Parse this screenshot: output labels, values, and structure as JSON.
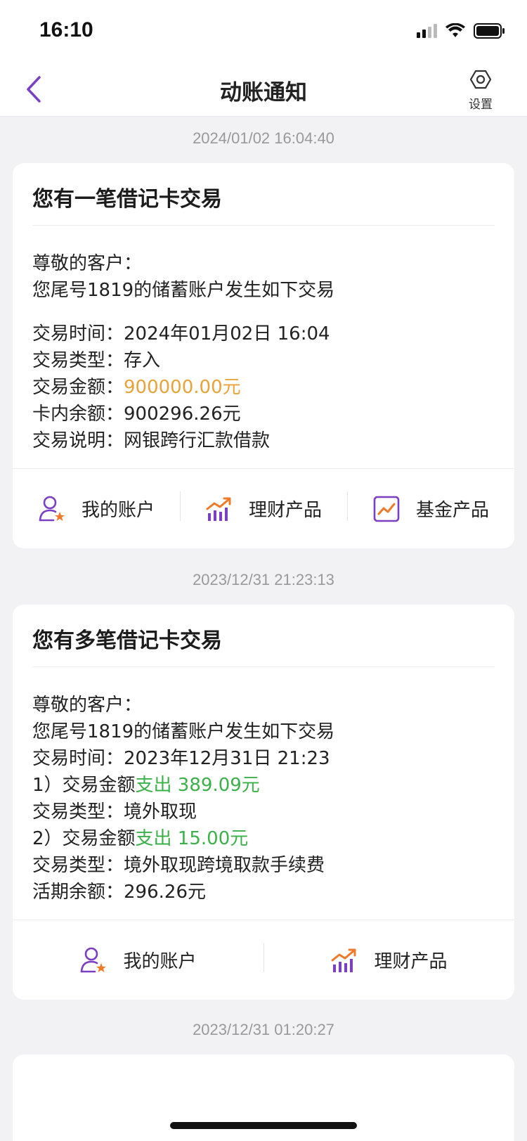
{
  "status": {
    "time": "16:10"
  },
  "nav": {
    "title": "动账通知",
    "settings_label": "设置"
  },
  "notifications": [
    {
      "timestamp": "2024/01/02 16:04:40",
      "title": "您有一笔借记卡交易",
      "greeting": "尊敬的客户：",
      "intro": "您尾号1819的储蓄账户发生如下交易",
      "time_label": "交易时间：",
      "time_value": "2024年01月02日  16:04",
      "type_label": "交易类型：",
      "type_value": "存入",
      "amount_label": "交易金额：",
      "amount_value": "900000.00元",
      "balance_label": "卡内余额：",
      "balance_value": "900296.26元",
      "desc_label": "交易说明：",
      "desc_value": "网银跨行汇款借款",
      "actions": [
        "我的账户",
        "理财产品",
        "基金产品"
      ]
    },
    {
      "timestamp": "2023/12/31 21:23:13",
      "title": "您有多笔借记卡交易",
      "greeting": "尊敬的客户：",
      "intro": "您尾号1819的储蓄账户发生如下交易",
      "time_label": "交易时间：",
      "time_value": "2023年12月31日  21:23",
      "item1_label": "1）交易金额",
      "item1_value": "支出 389.09元",
      "item1_type_label": "交易类型：",
      "item1_type_value": "境外取现",
      "item2_label": "2）交易金额",
      "item2_value": "支出 15.00元",
      "item2_type_label": "交易类型：",
      "item2_type_value": "境外取现跨境取款手续费",
      "balance_label": "活期余额：",
      "balance_value": "296.26元",
      "actions": [
        "我的账户",
        "理财产品"
      ]
    },
    {
      "timestamp": "2023/12/31 01:20:27"
    }
  ],
  "colors": {
    "accent": "#7b3fc4",
    "amount_in": "#e8a33a",
    "amount_out": "#3bb14a",
    "star": "#f07a2a"
  }
}
